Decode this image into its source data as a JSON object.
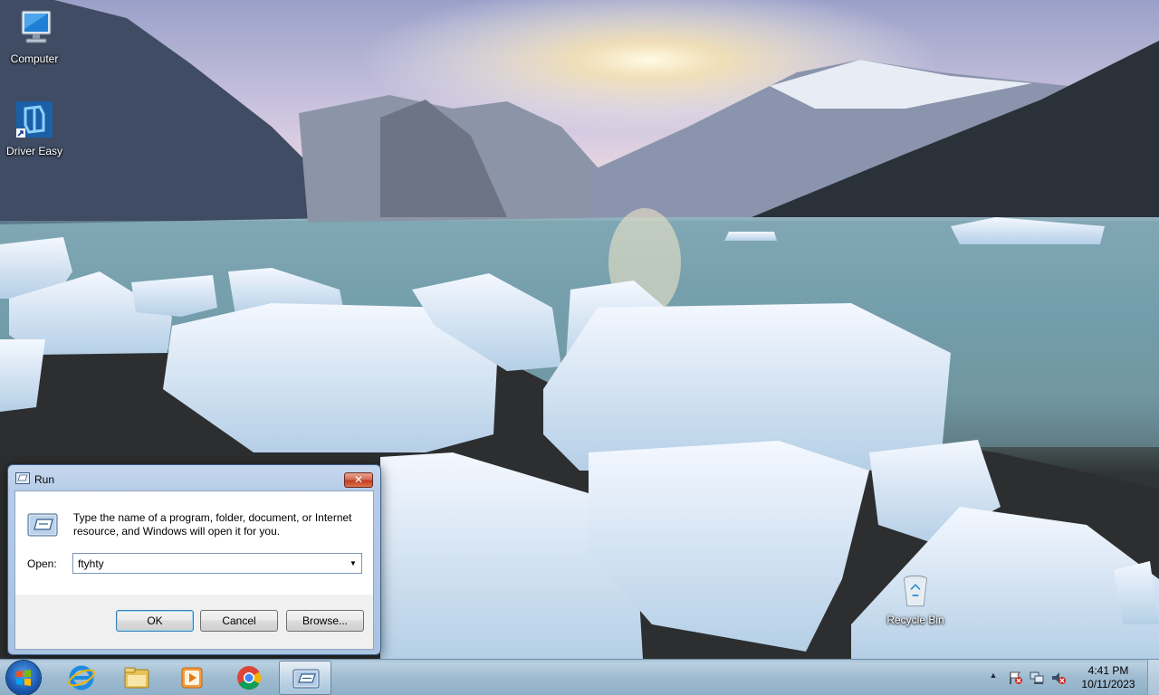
{
  "desktop": {
    "icons": [
      {
        "label": "Computer",
        "icon": "computer-icon"
      },
      {
        "label": "Driver Easy",
        "icon": "driver-easy-icon"
      },
      {
        "label": "Recycle Bin",
        "icon": "recycle-bin-icon"
      }
    ]
  },
  "run_dialog": {
    "title": "Run",
    "close_label": "✕",
    "description": "Type the name of a program, folder, document, or Internet resource, and Windows will open it for you.",
    "open_label": "Open:",
    "open_value": "ftyhty",
    "buttons": {
      "ok": "OK",
      "cancel": "Cancel",
      "browse": "Browse..."
    }
  },
  "taskbar": {
    "pinned": [
      {
        "name": "internet-explorer-icon"
      },
      {
        "name": "file-explorer-icon"
      },
      {
        "name": "media-player-icon"
      },
      {
        "name": "chrome-icon"
      },
      {
        "name": "run-icon",
        "active": true
      }
    ],
    "tray": {
      "show_hidden_label": "▲",
      "icons": [
        "action-center-flag-icon",
        "network-icon",
        "volume-muted-icon"
      ],
      "time": "4:41 PM",
      "date": "10/11/2023"
    }
  },
  "colors": {
    "taskbar": "#9fbbd0",
    "dialog_frame": "#b6cce8",
    "close_button": "#c2391d"
  }
}
